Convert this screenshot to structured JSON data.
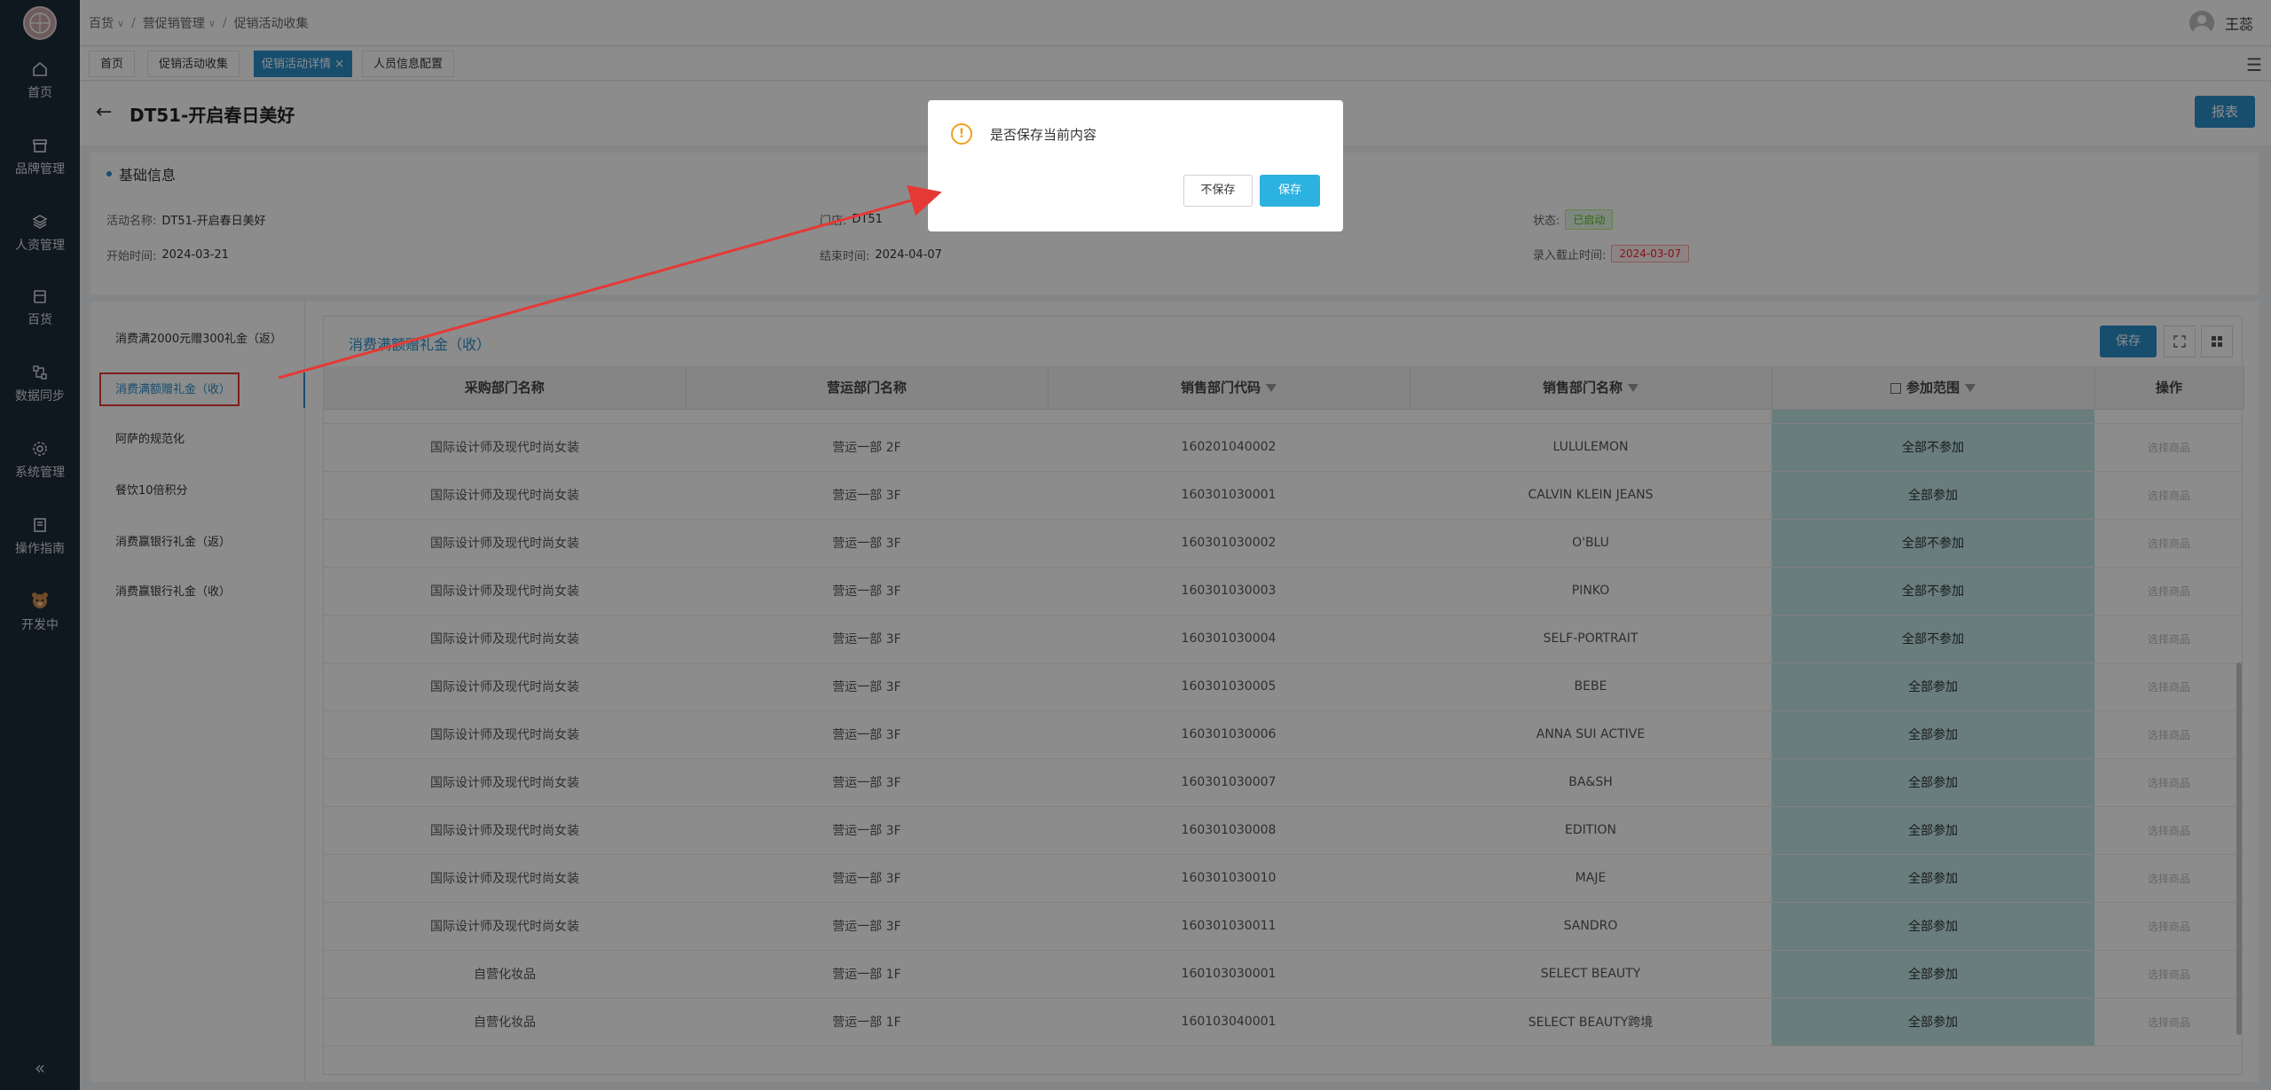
{
  "sidebar": {
    "items": [
      {
        "label": "首页",
        "icon": "home-icon"
      },
      {
        "label": "品牌管理",
        "icon": "box-icon"
      },
      {
        "label": "人资管理",
        "icon": "layers-icon"
      },
      {
        "label": "百货",
        "icon": "bag-icon"
      },
      {
        "label": "数据同步",
        "icon": "sync-icon"
      },
      {
        "label": "系统管理",
        "icon": "gear-icon"
      },
      {
        "label": "操作指南",
        "icon": "book-icon"
      },
      {
        "label": "开发中",
        "icon": "bear-icon"
      }
    ],
    "collapse_label": "«"
  },
  "breadcrumb": {
    "items": [
      "百货",
      "营促销管理",
      "促销活动收集"
    ],
    "sep": "/",
    "chev": "∨"
  },
  "user": {
    "name": "王蕊"
  },
  "tabs": {
    "items": [
      "首页",
      "促销活动收集",
      "促销活动详情 ×",
      "人员信息配置"
    ],
    "menu": "☰"
  },
  "page": {
    "back": "←",
    "title": "DT51-开启春日美好",
    "report_button": "报表"
  },
  "info": {
    "section_title": "基础信息",
    "name_label": "活动名称:",
    "name_value": "DT51-开启春日美好",
    "store_label": "门店:",
    "store_value": "DT51",
    "status_label": "状态:",
    "status_value": "已启动",
    "start_label": "开始时间:",
    "start_value": "2024-03-21",
    "end_label": "结束时间:",
    "end_value": "2024-04-07",
    "deadline_label": "录入截止时间:",
    "deadline_value": "2024-03-07"
  },
  "left_list": {
    "items": [
      "消费满2000元赠300礼金（返）",
      "消费满额赠礼金（收）",
      "阿萨的规范化",
      "餐饮10倍积分",
      "消费赢银行礼金（返）",
      "消费赢银行礼金（收）"
    ]
  },
  "panel": {
    "title": "消费满额赠礼金（收）",
    "save_button": "保存",
    "headers": [
      "采购部门名称",
      "营运部门名称",
      "销售部门代码",
      "销售部门名称",
      "参加范围",
      "操作"
    ],
    "rows": [
      [
        "国际设计师及现代时尚女装",
        "营运一部 2F",
        "160201040002",
        "LULULEMON",
        "全部不参加",
        "选择商品"
      ],
      [
        "国际设计师及现代时尚女装",
        "营运一部 3F",
        "160301030001",
        "CALVIN KLEIN JEANS",
        "全部参加",
        "选择商品"
      ],
      [
        "国际设计师及现代时尚女装",
        "营运一部 3F",
        "160301030002",
        "O'BLU",
        "全部不参加",
        "选择商品"
      ],
      [
        "国际设计师及现代时尚女装",
        "营运一部 3F",
        "160301030003",
        "PINKO",
        "全部不参加",
        "选择商品"
      ],
      [
        "国际设计师及现代时尚女装",
        "营运一部 3F",
        "160301030004",
        "SELF-PORTRAIT",
        "全部不参加",
        "选择商品"
      ],
      [
        "国际设计师及现代时尚女装",
        "营运一部 3F",
        "160301030005",
        "BEBE",
        "全部参加",
        "选择商品"
      ],
      [
        "国际设计师及现代时尚女装",
        "营运一部 3F",
        "160301030006",
        "ANNA SUI ACTIVE",
        "全部参加",
        "选择商品"
      ],
      [
        "国际设计师及现代时尚女装",
        "营运一部 3F",
        "160301030007",
        "BA&SH",
        "全部参加",
        "选择商品"
      ],
      [
        "国际设计师及现代时尚女装",
        "营运一部 3F",
        "160301030008",
        "EDITION",
        "全部参加",
        "选择商品"
      ],
      [
        "国际设计师及现代时尚女装",
        "营运一部 3F",
        "160301030010",
        "MAJE",
        "全部参加",
        "选择商品"
      ],
      [
        "国际设计师及现代时尚女装",
        "营运一部 3F",
        "160301030011",
        "SANDRO",
        "全部参加",
        "选择商品"
      ],
      [
        "自营化妆品",
        "营运一部 1F",
        "160103030001",
        "SELECT BEAUTY",
        "全部参加",
        "选择商品"
      ],
      [
        "自营化妆品",
        "营运一部 1F",
        "160103040001",
        "SELECT BEAUTY跨境",
        "全部参加",
        "选择商品"
      ]
    ]
  },
  "modal": {
    "icon": "!",
    "message": "是否保存当前内容",
    "no_save": "不保存",
    "save": "保存"
  },
  "colors": {
    "sidebar": "#1d2b3a",
    "accent": "#2b8fc8",
    "highlight_box": "#e53935",
    "scope_cell": "#bfe3e3"
  }
}
